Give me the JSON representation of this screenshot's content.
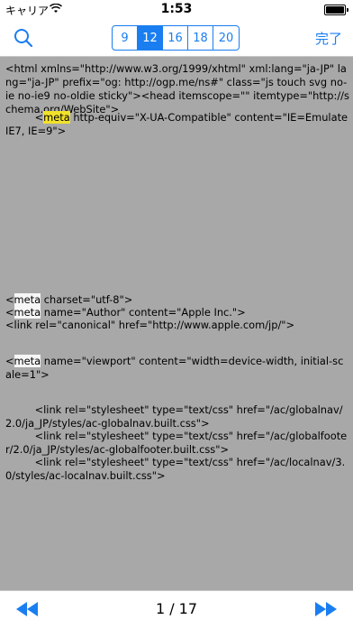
{
  "status": {
    "carrier": "キャリア",
    "time": "1:53"
  },
  "toolbar_top": {
    "font_sizes": [
      {
        "label": "9",
        "selected": false
      },
      {
        "label": "12",
        "selected": true
      },
      {
        "label": "16",
        "selected": false
      },
      {
        "label": "18",
        "selected": false
      },
      {
        "label": "20",
        "selected": false
      }
    ],
    "done_label": "完了"
  },
  "source": {
    "line1": "<html xmlns=\"http://www.w3.org/1999/xhtml\" xml:lang=\"ja-JP\" lang=\"ja-JP\" prefix=\"og: http://ogp.me/ns#\" class=\"js touch svg no-ie no-ie9 no-oldie sticky\"><head itemscope=\"\" itemtype=\"http://schema.org/WebSite\">",
    "line2_indent": "         <",
    "line2_tag": "meta",
    "line2_rest": " http-equiv=\"X-UA-Compatible\" content=\"IE=EmulateIE7, IE=9\">",
    "line3_lt": "<",
    "line3_tag": "meta",
    "line3_rest": " charset=\"utf-8\">",
    "line4_lt": "<",
    "line4_tag": "meta",
    "line4_rest": " name=\"Author\" content=\"Apple Inc.\">",
    "line5": "<link rel=\"canonical\" href=\"http://www.apple.com/jp/\">",
    "line6_lt": "<",
    "line6_tag": "meta",
    "line6_rest": " name=\"viewport\" content=\"width=device-width, initial-scale=1\">",
    "line7": "         <link rel=\"stylesheet\" type=\"text/css\" href=\"/ac/globalnav/2.0/ja_JP/styles/ac-globalnav.built.css\">",
    "line8": "         <link rel=\"stylesheet\" type=\"text/css\" href=\"/ac/globalfooter/2.0/ja_JP/styles/ac-globalfooter.built.css\">",
    "line9": "         <link rel=\"stylesheet\" type=\"text/css\" href=\"/ac/localnav/3.0/styles/ac-localnav.built.css\">"
  },
  "pager": {
    "page_indicator": "1 / 17"
  },
  "colors": {
    "accent": "#1a7ef1",
    "highlight_current": "#f2e22a",
    "highlight_match": "#f6f6f6",
    "background": "#a8a8a8"
  }
}
